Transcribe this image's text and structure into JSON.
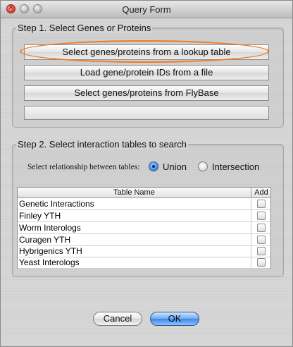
{
  "window": {
    "title": "Query Form"
  },
  "step1": {
    "label": "Step 1. Select Genes or Proteins",
    "buttons": [
      "Select genes/proteins from a lookup table",
      "Load gene/protein IDs from a file",
      "Select genes/proteins from FlyBase"
    ]
  },
  "step2": {
    "label": "Step 2. Select interaction tables to search",
    "relationship_label": "Select relationship between tables:",
    "options": [
      "Union",
      "Intersection"
    ],
    "selected": "Union",
    "table": {
      "headers": [
        "Table Name",
        "Add"
      ],
      "rows": [
        "Genetic Interactions",
        "Finley YTH",
        "Worm Interologs",
        "Curagen YTH",
        "Hybrigenics YTH",
        "Yeast Interologs"
      ]
    }
  },
  "footer": {
    "cancel": "Cancel",
    "ok": "OK"
  },
  "colors": {
    "highlight": "#ee7a22",
    "accent": "#3f86e6"
  }
}
